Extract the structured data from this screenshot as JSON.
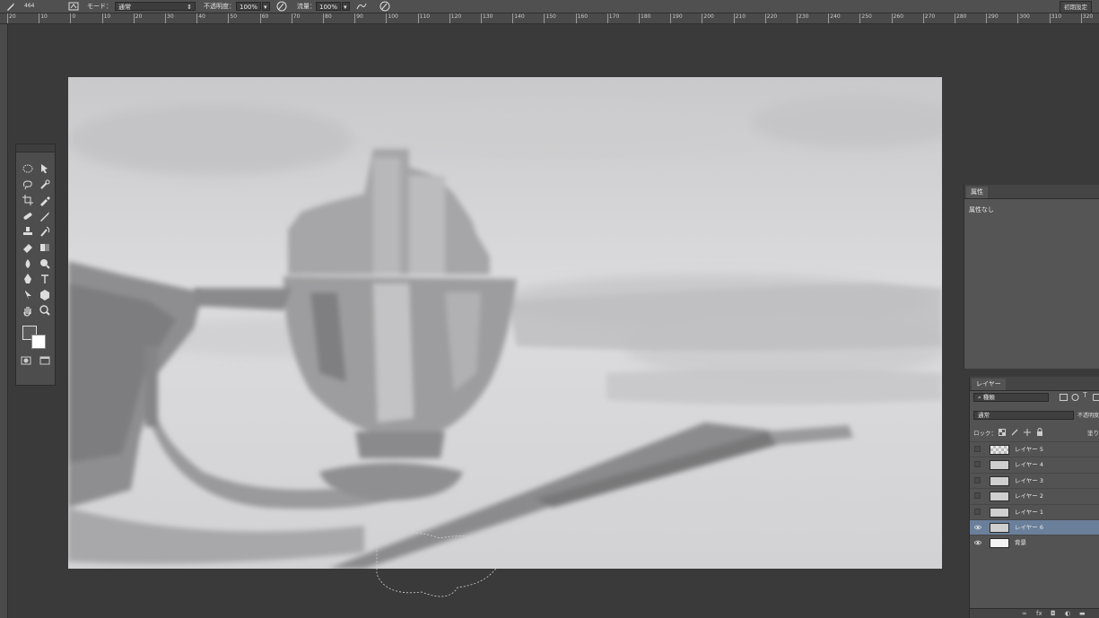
{
  "options_bar": {
    "brush_size": "464",
    "mode_label": "モード：",
    "mode_value": "通常",
    "opacity_label": "不透明度：",
    "opacity_value": "100%",
    "flow_label": "流量：",
    "flow_value": "100%",
    "reset_label": "初期設定"
  },
  "ruler": {
    "ticks": [
      "20",
      "10",
      "0",
      "10",
      "20",
      "30",
      "40",
      "50",
      "60",
      "70",
      "80",
      "90",
      "100",
      "110",
      "120",
      "130",
      "140",
      "150",
      "160",
      "170",
      "180",
      "190",
      "200",
      "210",
      "220",
      "230",
      "240",
      "250",
      "260",
      "270",
      "280",
      "290",
      "300",
      "310",
      "320"
    ]
  },
  "properties_panel": {
    "tab_label": "属性",
    "empty_text": "属性なし"
  },
  "layers_panel": {
    "tab_label": "レイヤー",
    "filter_value": "種類",
    "blend_mode": "通常",
    "opacity_label": "不透明度",
    "lock_label": "ロック：",
    "fill_label": "塗り",
    "layers": [
      {
        "name": "レイヤー 5",
        "visible": false,
        "selected": false,
        "thumb": "checker"
      },
      {
        "name": "レイヤー 4",
        "visible": false,
        "selected": false,
        "thumb": "sketch"
      },
      {
        "name": "レイヤー 3",
        "visible": false,
        "selected": false,
        "thumb": "sketch"
      },
      {
        "name": "レイヤー 2",
        "visible": false,
        "selected": false,
        "thumb": "sketch"
      },
      {
        "name": "レイヤー 1",
        "visible": false,
        "selected": false,
        "thumb": "sketch"
      },
      {
        "name": "レイヤー 6",
        "visible": true,
        "selected": true,
        "thumb": "sketch"
      },
      {
        "name": "背景",
        "visible": true,
        "selected": false,
        "thumb": "white"
      }
    ],
    "footer_icons": [
      "link-icon",
      "fx-icon",
      "mask-icon",
      "adjustment-icon",
      "folder-icon"
    ]
  },
  "tools": [
    "ellipse-marquee-icon",
    "move-icon",
    "lasso-icon",
    "quick-select-icon",
    "crop-icon",
    "eyedropper-icon",
    "spot-heal-icon",
    "brush-icon",
    "stamp-icon",
    "history-brush-icon",
    "eraser-icon",
    "gradient-icon",
    "blur-icon",
    "dodge-icon",
    "pen-icon",
    "type-icon",
    "path-select-icon",
    "shape-icon",
    "hand-icon",
    "zoom-icon"
  ],
  "colors": {
    "foreground": "#5a5a5a",
    "background": "#ffffff",
    "selected_layer": "#6a7f9a"
  }
}
